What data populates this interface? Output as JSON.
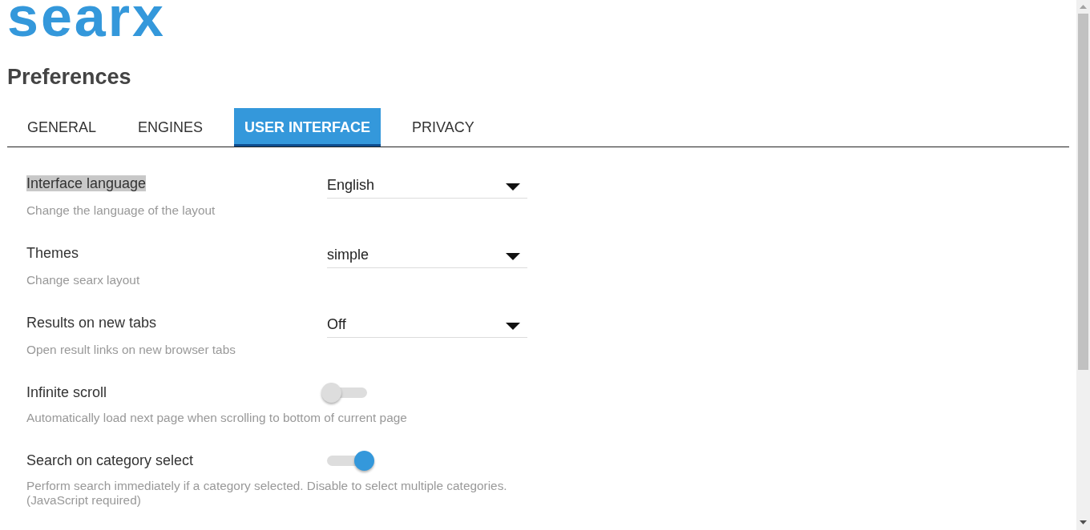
{
  "logo": "searx",
  "title": "Preferences",
  "tabs": [
    {
      "label": "GENERAL",
      "selected": false
    },
    {
      "label": "ENGINES",
      "selected": false
    },
    {
      "label": "USER INTERFACE",
      "selected": true
    },
    {
      "label": "PRIVACY",
      "selected": false
    }
  ],
  "settings": [
    {
      "kind": "select",
      "label": "Interface language",
      "highlighted": true,
      "value": "English",
      "description": "Change the language of the layout"
    },
    {
      "kind": "select",
      "label": "Themes",
      "highlighted": false,
      "value": "simple",
      "description": "Change searx layout"
    },
    {
      "kind": "select",
      "label": "Results on new tabs",
      "highlighted": false,
      "value": "Off",
      "description": "Open result links on new browser tabs"
    },
    {
      "kind": "toggle",
      "label": "Infinite scroll",
      "highlighted": false,
      "on": false,
      "description": "Automatically load next page when scrolling to bottom of current page"
    },
    {
      "kind": "toggle",
      "label": "Search on category select",
      "highlighted": false,
      "on": true,
      "description": "Perform search immediately if a category selected. Disable to select multiple categories. (JavaScript required)"
    }
  ]
}
